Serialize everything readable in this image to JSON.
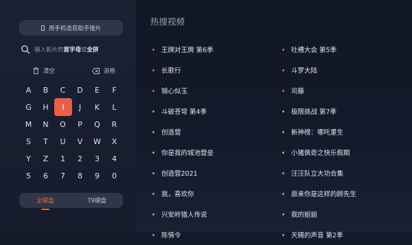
{
  "left": {
    "voice_button": "用手机语音助手搜片",
    "search": {
      "part1": "输入影片的",
      "bold1": "首字母",
      "part2": "或",
      "bold2": "全拼"
    },
    "clear_label": "清空",
    "backspace_label": "退格",
    "keys": [
      "A",
      "B",
      "C",
      "D",
      "E",
      "F",
      "G",
      "H",
      "I",
      "J",
      "K",
      "L",
      "M",
      "N",
      "O",
      "P",
      "Q",
      "R",
      "S",
      "T",
      "U",
      "V",
      "W",
      "X",
      "Y",
      "Z",
      "1",
      "2",
      "3",
      "4",
      "5",
      "6",
      "7",
      "8",
      "9",
      "0"
    ],
    "active_key": "I",
    "tabs": [
      {
        "label": "全键盘",
        "active": true
      },
      {
        "label": "T9键盘",
        "active": false
      }
    ]
  },
  "right": {
    "title": "热搜视频",
    "column1": [
      {
        "title": "王牌对王牌 第6季",
        "dot": "#e8604c"
      },
      {
        "title": "长歌行",
        "dot": "#e8604c"
      },
      {
        "title": "锦心似玉",
        "dot": "#e8604c"
      },
      {
        "title": "斗破苍穹 第4季",
        "dot": "#d9a43a"
      },
      {
        "title": "创造营",
        "dot": "#d9a43a"
      },
      {
        "title": "你是我的城池营垒",
        "dot": "#d9a43a"
      },
      {
        "title": "创造营2021",
        "dot": "#9aa0ae"
      },
      {
        "title": "我，喜欢你",
        "dot": "#9aa0ae"
      },
      {
        "title": "兴安岭猎人传说",
        "dot": "#9aa0ae"
      },
      {
        "title": "陈情令",
        "dot": "#9aa0ae"
      }
    ],
    "column2": [
      {
        "title": "吐槽大会 第5季",
        "dot": "#e8604c"
      },
      {
        "title": "斗罗大陆",
        "dot": "#e8604c"
      },
      {
        "title": "司藤",
        "dot": "#e8604c"
      },
      {
        "title": "极限挑战 第7季",
        "dot": "#d9a43a"
      },
      {
        "title": "新神榜：哪吒重生",
        "dot": "#d9a43a"
      },
      {
        "title": "小猪佩奇之快乐假期",
        "dot": "#d9a43a"
      },
      {
        "title": "汪汪队立大功合集",
        "dot": "#9aa0ae"
      },
      {
        "title": "原来你是这样的顾先生",
        "dot": "#9aa0ae"
      },
      {
        "title": "我的姐姐",
        "dot": "#9aa0ae"
      },
      {
        "title": "天赐的声音 第2季",
        "dot": "#9aa0ae"
      }
    ]
  }
}
